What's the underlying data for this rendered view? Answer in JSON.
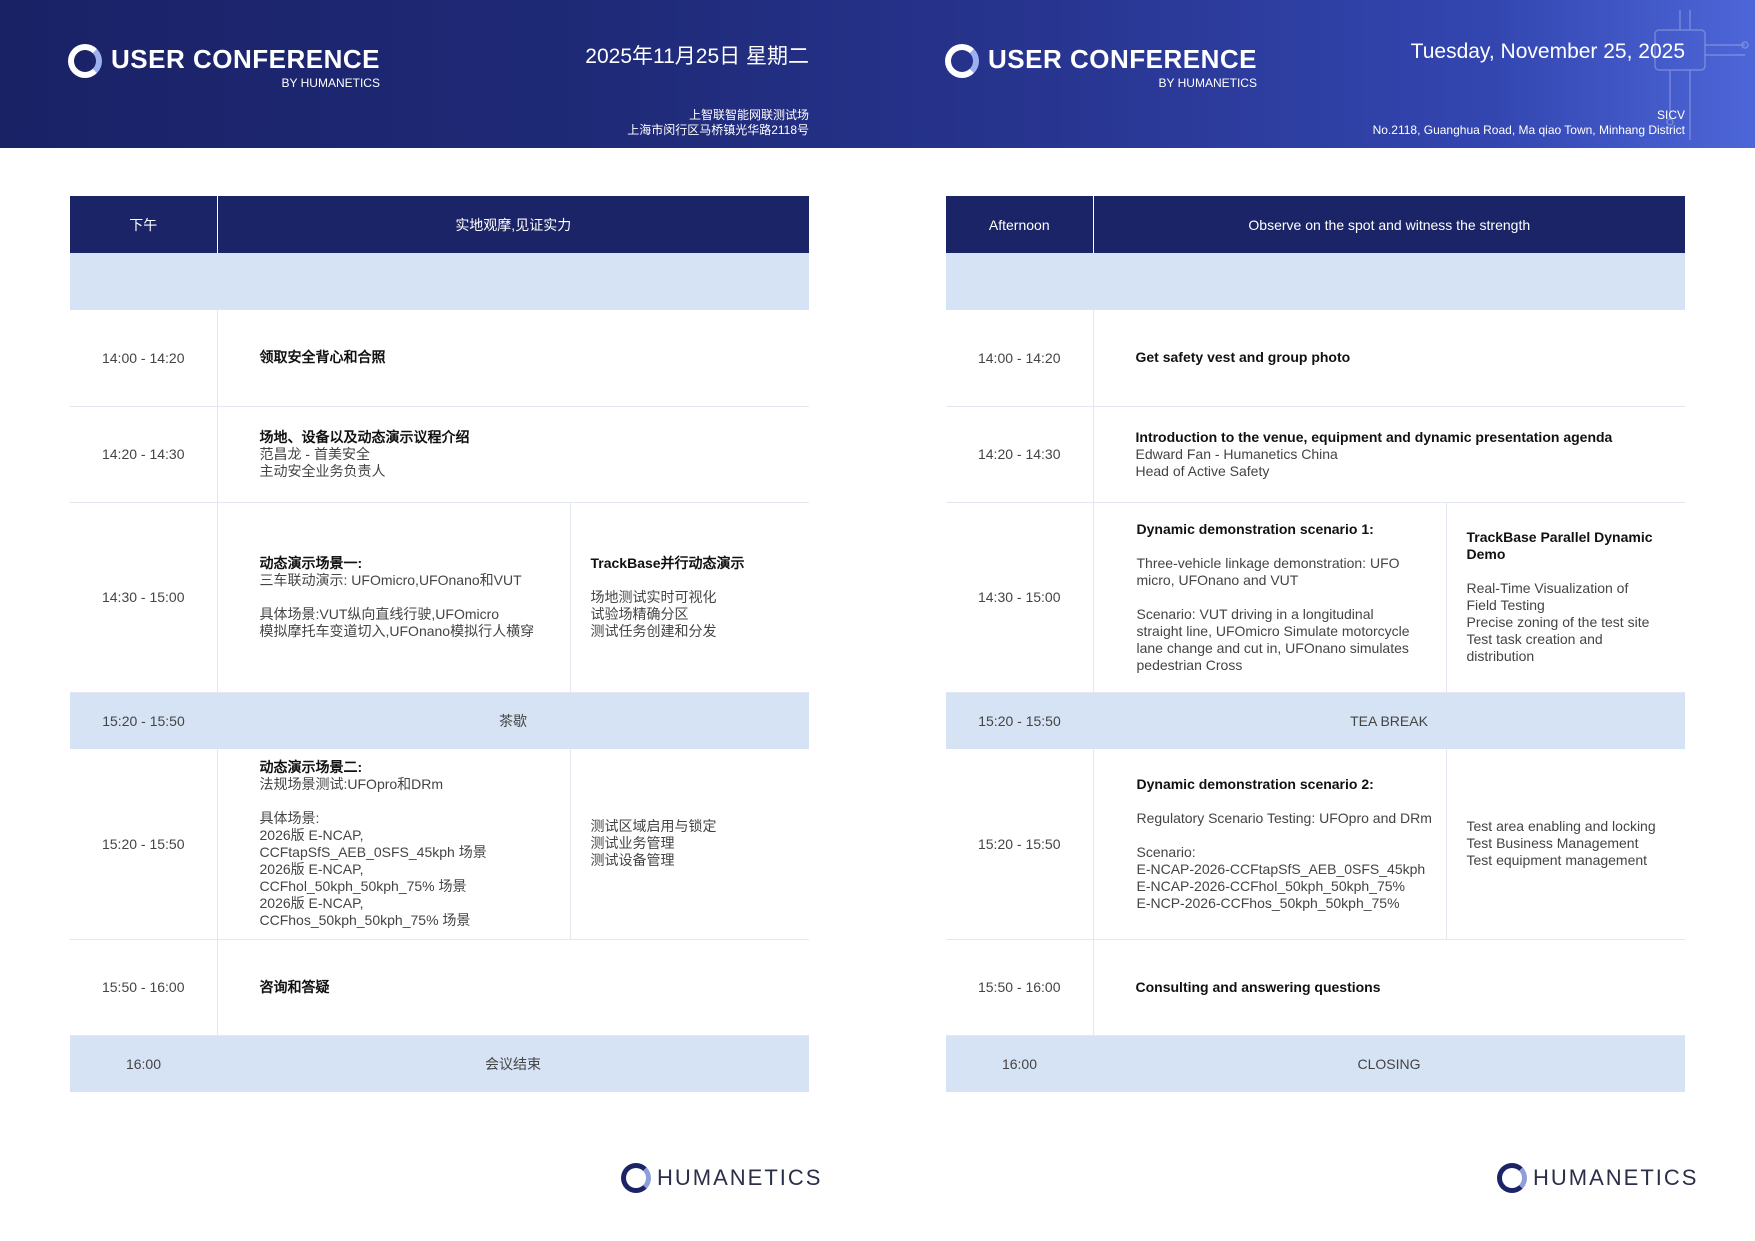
{
  "brand": {
    "title": "USER CONFERENCE",
    "subtitle": "BY HUMANETICS"
  },
  "footer_brand": "HUMANETICS",
  "zh": {
    "date": "2025年11月25日 星期二",
    "venue_name": "上智联智能网联测试场",
    "venue_address": "上海市闵行区马桥镇光华路2118号",
    "header": {
      "period": "下午",
      "theme": "实地观摩,见证实力"
    },
    "rows": [
      {
        "time": "14:00 - 14:20",
        "title": "领取安全背心和合照"
      },
      {
        "time": "14:20 - 14:30",
        "title": "场地、设备以及动态演示议程介绍",
        "lines": [
          "范昌龙 - 首美安全",
          "主动安全业务负责人"
        ]
      },
      {
        "time": "14:30 - 15:00",
        "title": "动态演示场景一:",
        "lines": [
          "三车联动演示: UFOmicro,UFOnano和VUT",
          "",
          "具体场景:VUT纵向直线行驶,UFOmicro",
          "模拟摩托车变道切入,UFOnano模拟行人横穿"
        ],
        "side_title": "TrackBase并行动态演示",
        "side_lines": [
          "",
          "场地测试实时可视化",
          "试验场精确分区",
          "测试任务创建和分发"
        ]
      },
      {
        "time": "15:20 - 15:50",
        "label": "茶歇"
      },
      {
        "time": "15:20 - 15:50",
        "title": "动态演示场景二:",
        "lines": [
          "法规场景测试:UFOpro和DRm",
          "",
          "具体场景:",
          "2026版 E-NCAP,",
          "CCFtapSfS_AEB_0SFS_45kph 场景",
          "2026版 E-NCAP,",
          "CCFhol_50kph_50kph_75% 场景",
          "2026版 E-NCAP,",
          "CCFhos_50kph_50kph_75% 场景"
        ],
        "side_lines": [
          "测试区域启用与锁定",
          "测试业务管理",
          "测试设备管理"
        ]
      },
      {
        "time": "15:50 - 16:00",
        "title": "咨询和答疑"
      },
      {
        "time": "16:00",
        "label": "会议结束"
      }
    ]
  },
  "en": {
    "date": "Tuesday, November 25, 2025",
    "venue_name": "SICV",
    "venue_address": "No.2118, Guanghua Road, Ma qiao Town, Minhang District",
    "header": {
      "period": "Afternoon",
      "theme": "Observe on the spot and witness the strength"
    },
    "rows": [
      {
        "time": "14:00 - 14:20",
        "title": "Get safety vest and group photo"
      },
      {
        "time": "14:20 - 14:30",
        "title": "Introduction to the venue, equipment and dynamic presentation agenda",
        "lines": [
          "Edward Fan - Humanetics China",
          "Head of Active Safety"
        ]
      },
      {
        "time": "14:30 - 15:00",
        "title": "Dynamic demonstration scenario 1:",
        "lines": [
          "",
          "Three-vehicle linkage demonstration: UFO",
          "micro, UFOnano and VUT",
          "",
          "Scenario: VUT driving in a longitudinal",
          "straight line, UFOmicro Simulate motorcycle",
          "lane change and cut in, UFOnano simulates",
          "pedestrian Cross"
        ],
        "side_title": "TrackBase Parallel Dynamic Demo",
        "side_lines": [
          "",
          "Real-Time Visualization of",
          "Field Testing",
          "Precise zoning of the test site",
          "Test task creation and",
          "distribution"
        ]
      },
      {
        "time": "15:20 - 15:50",
        "label": "TEA BREAK"
      },
      {
        "time": "15:20 - 15:50",
        "title": "Dynamic demonstration scenario 2:",
        "lines": [
          "",
          "Regulatory Scenario Testing: UFOpro and DRm",
          "",
          "Scenario:",
          "E-NCAP-2026-CCFtapSfS_AEB_0SFS_45kph",
          "E-NCAP-2026-CCFhol_50kph_50kph_75%",
          "E-NCP-2026-CCFhos_50kph_50kph_75%"
        ],
        "side_lines": [
          "Test area enabling and locking",
          "Test Business Management",
          "Test equipment management"
        ]
      },
      {
        "time": "15:50 - 16:00",
        "title": "Consulting and answering questions"
      },
      {
        "time": "16:00",
        "label": "CLOSING"
      }
    ]
  }
}
